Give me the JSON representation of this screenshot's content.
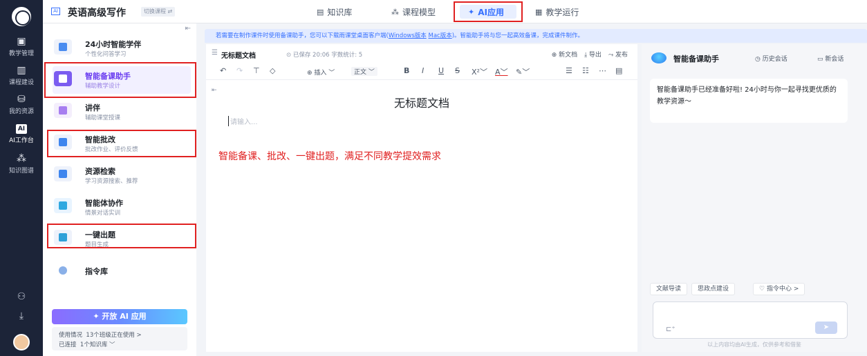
{
  "rail": {
    "items": [
      {
        "icon": "teaching-icon",
        "label": "教学管理"
      },
      {
        "icon": "course-icon",
        "label": "课程建设"
      },
      {
        "icon": "resource-icon",
        "label": "我的资源"
      },
      {
        "icon": "ai-icon",
        "label": "AI工作台",
        "badge": "AI"
      },
      {
        "icon": "knowledge-graph-icon",
        "label": "知识图谱"
      }
    ]
  },
  "topbar": {
    "ai_badge": "AI",
    "title": "英语高级写作",
    "switch_label": "切换课程 ⇄",
    "nav": [
      {
        "label": "知识库"
      },
      {
        "label": "课程模型"
      },
      {
        "label": "AI应用"
      },
      {
        "label": "教学运行"
      }
    ]
  },
  "sidebar": {
    "items": [
      {
        "title": "24小时智能学伴",
        "subtitle": "个性化问答学习"
      },
      {
        "title": "智能备课助手",
        "subtitle": "辅助教学设计"
      },
      {
        "title": "讲伴",
        "subtitle": "辅助课堂授课"
      },
      {
        "title": "智能批改",
        "subtitle": "批改作业、评价反馈"
      },
      {
        "title": "资源检索",
        "subtitle": "学习资源搜索、推荐"
      },
      {
        "title": "智能体协作",
        "subtitle": "情景对话实训"
      },
      {
        "title": "一键出题",
        "subtitle": "题目生成"
      },
      {
        "title": "指令库",
        "subtitle": ""
      }
    ],
    "open_button": "✦ 开放 AI 应用",
    "usage_label": "使用情况",
    "usage_value": "13个班级正在使用 >",
    "connected_label": "已连接",
    "connected_value": "1个知识库 ﹀"
  },
  "notice": {
    "text_before": "若需要在制作课件时使用备课助手，您可以下载雨课堂桌面客户端(",
    "win": "Windows版本",
    "mac": "Mac版本",
    "text_after": ")。智能助手将与您一起高效备课，完成课件制作。"
  },
  "editor": {
    "doc_name": "无标题文档",
    "saved": "已保存 20:06  字数统计: 5",
    "new_doc": "⊕ 新文档",
    "export": "⤓ 导出",
    "publish": "⤳ 发布",
    "insert": "⊕ 插入 ﹀",
    "paragraph": "正文 ﹀",
    "title": "无标题文档",
    "placeholder": "请输入...",
    "annotation": "智能备课、批改、一键出题，满足不同教学提效需求"
  },
  "assistant": {
    "name": "智能备课助手",
    "history": "◷ 历史会话",
    "new_chat": "▭ 新会话",
    "greeting": "智能备课助手已经准备好啦! 24小时与你一起寻找更优质的教学资源～",
    "chips": [
      "文献导读",
      "思政点建设",
      "♡ 指令中心 >"
    ],
    "disclaimer": "以上内容均由AI生成，仅供参考和借鉴"
  },
  "colors": {
    "accent": "#3670ff",
    "annotation_red": "#e02020",
    "rail_bg": "#1c2438"
  }
}
